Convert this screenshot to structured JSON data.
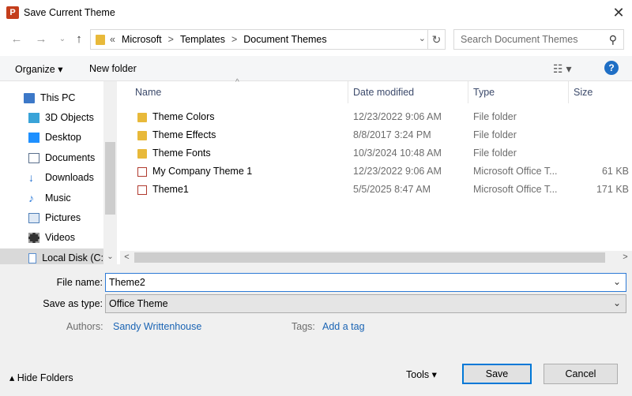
{
  "window": {
    "title": "Save Current Theme",
    "app_icon_letter": "P",
    "close": "✕"
  },
  "address": {
    "back": "←",
    "forward": "→",
    "up": "↑",
    "overflow": "«",
    "path": [
      "Microsoft",
      "Templates",
      "Document Themes"
    ],
    "separator": ">",
    "refresh": "↻"
  },
  "search": {
    "placeholder": "Search Document Themes",
    "icon": "⚲"
  },
  "toolbar": {
    "organize": "Organize ▾",
    "new_folder": "New folder",
    "view": "☷ ▾",
    "help": "?"
  },
  "nav": {
    "items": [
      {
        "label": "This PC",
        "icon": "pc-icon",
        "color": "#3c78c8"
      },
      {
        "label": "3D Objects",
        "icon": "cube-icon",
        "color": "#39a3d8"
      },
      {
        "label": "Desktop",
        "icon": "desktop-icon",
        "color": "#1e90ff"
      },
      {
        "label": "Documents",
        "icon": "documents-icon",
        "color": "#5a6f8c"
      },
      {
        "label": "Downloads",
        "icon": "downloads-icon",
        "color": "#2270d0"
      },
      {
        "label": "Music",
        "icon": "music-icon",
        "color": "#2a7ad9"
      },
      {
        "label": "Pictures",
        "icon": "pictures-icon",
        "color": "#4f7fb8"
      },
      {
        "label": "Videos",
        "icon": "videos-icon",
        "color": "#333333"
      },
      {
        "label": "Local Disk (C:",
        "icon": "disk-icon",
        "color": "#5a8fd0"
      }
    ],
    "scroll_down": "⌄"
  },
  "columns": {
    "name": "Name",
    "date": "Date modified",
    "type": "Type",
    "size": "Size"
  },
  "files": [
    {
      "name": "Theme Colors",
      "date": "12/23/2022 9:06 AM",
      "type": "File folder",
      "size": "",
      "kind": "folder"
    },
    {
      "name": "Theme Effects",
      "date": "8/8/2017 3:24 PM",
      "type": "File folder",
      "size": "",
      "kind": "folder"
    },
    {
      "name": "Theme Fonts",
      "date": "10/3/2024 10:48 AM",
      "type": "File folder",
      "size": "",
      "kind": "folder"
    },
    {
      "name": "My Company Theme 1",
      "date": "12/23/2022 9:06 AM",
      "type": "Microsoft Office T...",
      "size": "61 KB",
      "kind": "theme"
    },
    {
      "name": "Theme1",
      "date": "5/5/2025 8:47 AM",
      "type": "Microsoft Office T...",
      "size": "171 KB",
      "kind": "theme"
    }
  ],
  "hscroll": {
    "left": "<",
    "right": ">"
  },
  "form": {
    "file_name_label": "File name:",
    "file_name_value": "Theme2",
    "save_type_label": "Save as type:",
    "save_type_value": "Office Theme",
    "dropdown": "⌄",
    "authors_label": "Authors:",
    "authors_value": "Sandy Writtenhouse",
    "tags_label": "Tags:",
    "tags_value": "Add a tag"
  },
  "footer": {
    "hide_folders": "▴  Hide Folders",
    "tools": "Tools  ▾",
    "save": "Save",
    "cancel": "Cancel"
  }
}
